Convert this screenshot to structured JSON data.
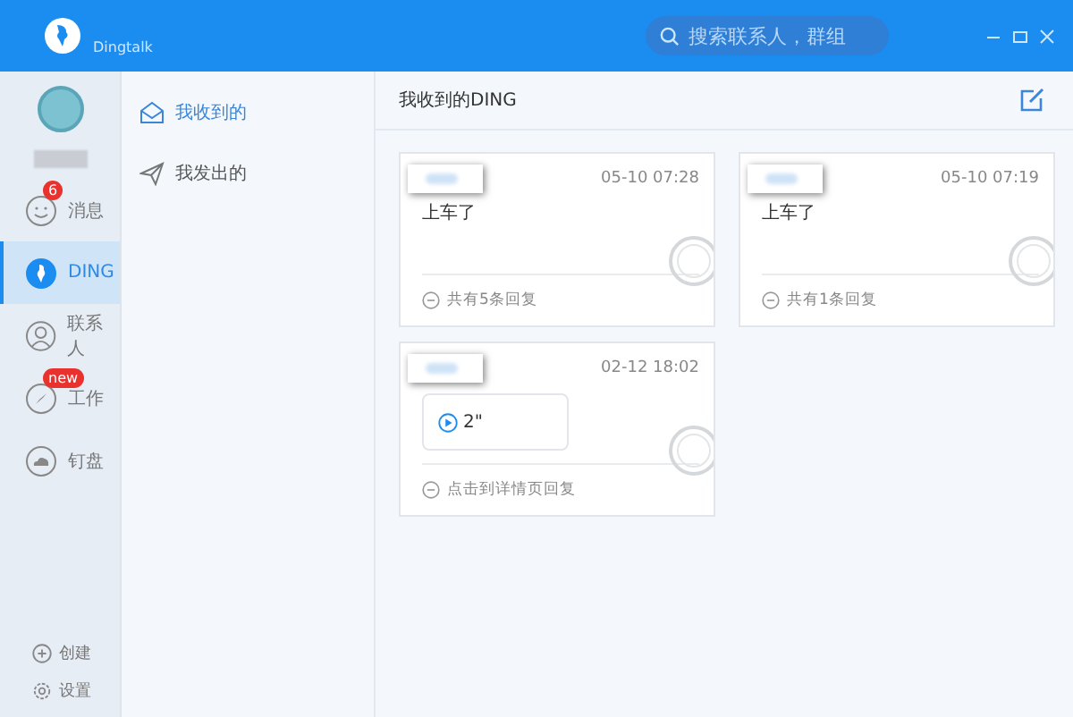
{
  "top_bar": {
    "logo_text": "Dingtalk",
    "search": {
      "placeholder": "搜索联系人，群组"
    }
  },
  "nav": {
    "items": [
      {
        "label": "消息",
        "badge": "6",
        "selected": false
      },
      {
        "label": "DING",
        "selected": true
      },
      {
        "label": "联系人",
        "selected": false
      },
      {
        "label": "工作",
        "badge": "new",
        "selected": false
      },
      {
        "label": "钉盘",
        "selected": false
      }
    ],
    "bottom": [
      "创建",
      "设置"
    ]
  },
  "sub_nav": [
    {
      "label": "我收到的",
      "selected": true
    },
    {
      "label": "我发出的",
      "selected": false
    }
  ],
  "main": {
    "title": "我收到的DING",
    "cards": [
      {
        "kind": "text",
        "time": "05-10 07:28",
        "body": "上车了",
        "footer": "共有5条回复"
      },
      {
        "kind": "text",
        "time": "05-10 07:19",
        "body": "上车了",
        "footer": "共有1条回复"
      },
      {
        "kind": "voice",
        "time": "02-12 18:02",
        "body": "2\"",
        "footer": "点击到详情页回复"
      }
    ]
  }
}
